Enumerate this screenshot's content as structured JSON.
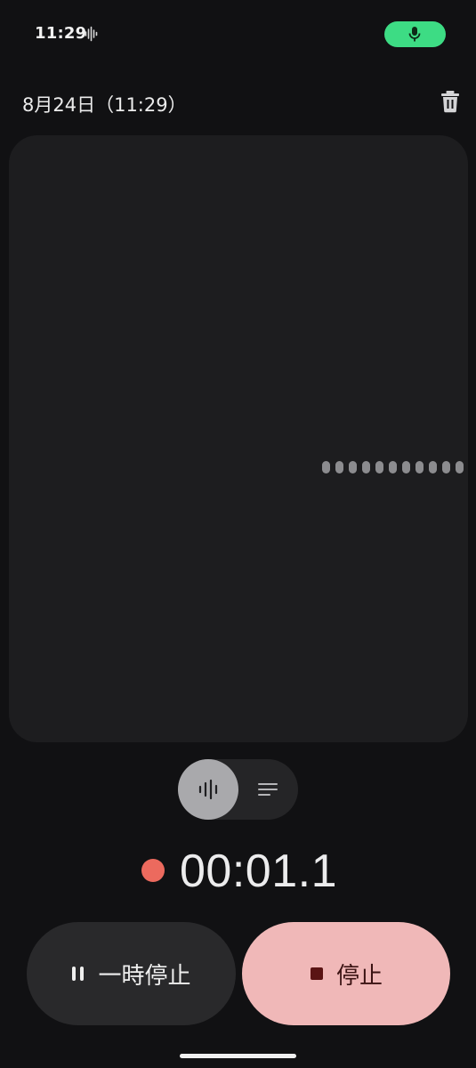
{
  "status_bar": {
    "time": "11:29",
    "icons": [
      "sound-wave-icon",
      "microphone-icon"
    ],
    "mic_indicator_color": "#3ddc84"
  },
  "recording": {
    "title": "8月24日（11:29）",
    "elapsed": "00:01.1",
    "indicator_color": "#ec6a5e"
  },
  "view_toggle": {
    "options": [
      "waveform-icon",
      "transcript-icon"
    ],
    "selected": "waveform"
  },
  "controls": {
    "pause_label": "一時停止",
    "stop_label": "停止",
    "stop_color": "#f0b8b8"
  },
  "icons": {
    "delete": "trash-icon"
  }
}
